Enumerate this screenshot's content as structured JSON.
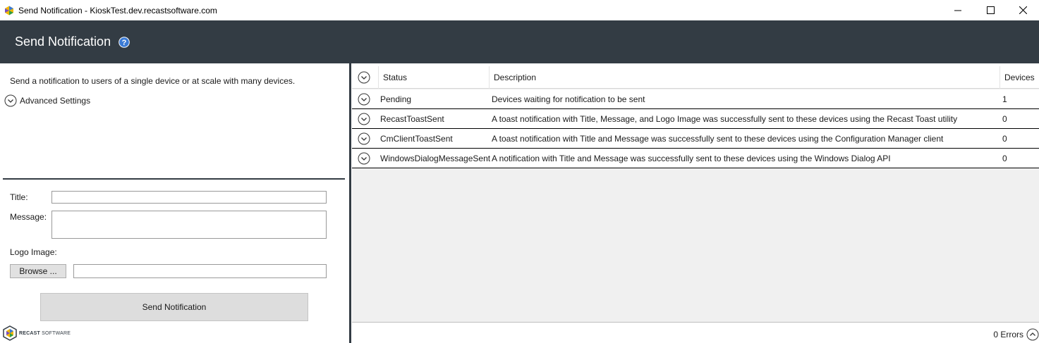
{
  "window": {
    "title": "Send Notification - KioskTest.dev.recastsoftware.com"
  },
  "banner": {
    "title": "Send Notification"
  },
  "left": {
    "description": "Send a notification to users of a single device or at scale with many devices.",
    "advanced_label": "Advanced Settings",
    "title_label": "Title:",
    "title_value": "",
    "message_label": "Message:",
    "message_value": "",
    "logo_label": "Logo Image:",
    "browse_label": "Browse ...",
    "logo_path": "",
    "send_label": "Send Notification",
    "brand_name": "RECAST",
    "brand_suffix": "SOFTWARE"
  },
  "grid": {
    "columns": [
      "Status",
      "Description",
      "Devices"
    ],
    "rows": [
      {
        "status": "Pending",
        "description": "Devices waiting for notification to be sent",
        "devices": "1"
      },
      {
        "status": "RecastToastSent",
        "description": "A toast notification with Title, Message, and Logo Image was successfully sent to these devices using the Recast Toast utility",
        "devices": "0"
      },
      {
        "status": "CmClientToastSent",
        "description": "A toast notification with Title and Message was successfully sent to these devices using the Configuration Manager client",
        "devices": "0"
      },
      {
        "status": "WindowsDialogMessageSent",
        "description": "A notification with Title and Message was successfully sent to these devices using the Windows Dialog API",
        "devices": "0"
      }
    ]
  },
  "status_bar": {
    "errors": "0 Errors"
  },
  "colors": {
    "banner": "#333c44",
    "help_icon": "#3b7bd6",
    "grid_background": "#f0f0f0"
  }
}
